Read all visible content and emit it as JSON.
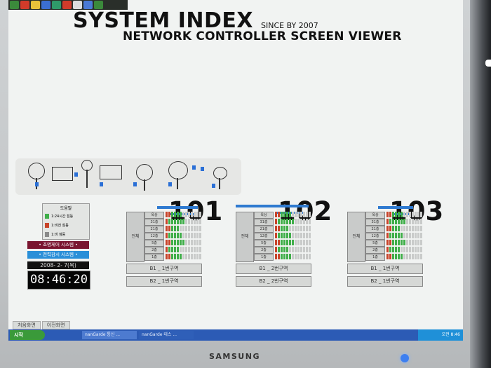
{
  "header": {
    "title": "SYSTEM INDEX",
    "since": "SINCE BY 2007",
    "subtitle": "NETWORK CONTROLLER SCREEN VIEWER"
  },
  "legend": {
    "title": "도움말",
    "items": [
      {
        "label": "1:24시간 점등",
        "color": "#3fae49"
      },
      {
        "label": "1:비전 점등",
        "color": "#c8442a"
      },
      {
        "label": "1:비 점등",
        "color": "#8a8a8a"
      }
    ]
  },
  "controls": {
    "btn_control": "• 조명제어 시스템 •",
    "btn_monitor": "• 전력감시 시스템 •",
    "date": "2008- 2- 7(목)",
    "time": "08:46:20"
  },
  "buildings": [
    {
      "number": "101",
      "side_label": "전체",
      "zones": [
        "B1 _ 1번구역",
        "B2 _ 1번구역"
      ]
    },
    {
      "number": "102",
      "side_label": "전체",
      "zones": [
        "B1 _ 2번구역",
        "B2 _ 2번구역"
      ]
    },
    {
      "number": "103",
      "side_label": "전체",
      "zones": [
        "B1 _ 1번구역",
        "B2 _ 1번구역"
      ]
    }
  ],
  "floors": [
    "옥상",
    "31층",
    "21층",
    "12층",
    "5층",
    "2층",
    "1층"
  ],
  "tabs": [
    "처음화면",
    "이전화면"
  ],
  "taskbar": {
    "start": "시작",
    "tasks": [
      "nanGarde 통신 ...",
      "nanGarde 테스 ..."
    ],
    "tray_time": "오전 8:46"
  },
  "monitor": {
    "brand": "SAMSUNG"
  },
  "colors": {
    "on": "#3fae49",
    "red": "#c8442a",
    "off": "#8a8a8a",
    "accent": "#2f7ad0"
  }
}
